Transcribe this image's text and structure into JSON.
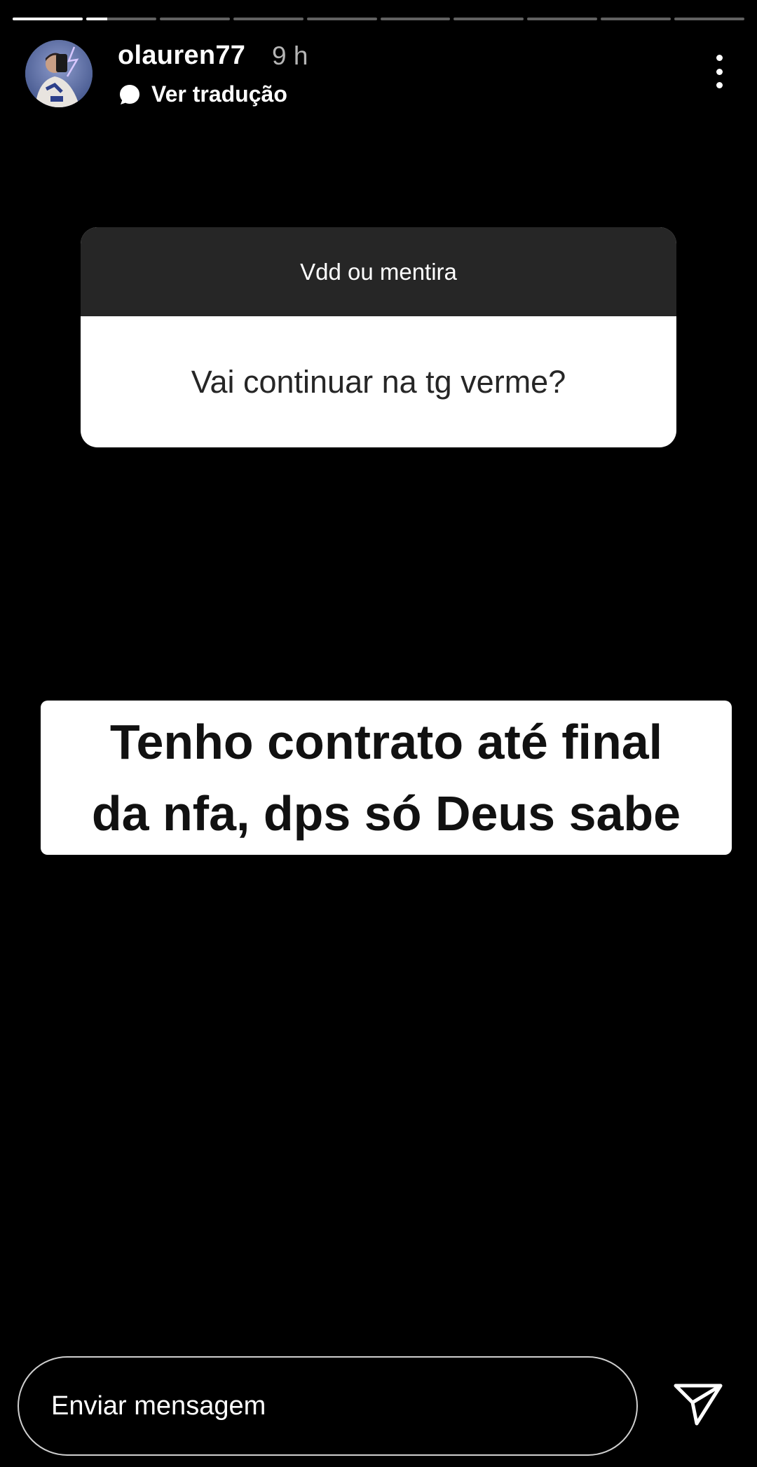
{
  "story": {
    "segments": [
      {
        "progress": 1.0
      },
      {
        "progress": 0.3
      },
      {
        "progress": 0
      },
      {
        "progress": 0
      },
      {
        "progress": 0
      },
      {
        "progress": 0
      },
      {
        "progress": 0
      },
      {
        "progress": 0
      },
      {
        "progress": 0
      },
      {
        "progress": 0
      }
    ]
  },
  "header": {
    "username": "olauren77",
    "time": "9 h",
    "translate_label": "Ver tradução",
    "avatar_icon": "profile-photo",
    "more_icon": "more-vertical-icon"
  },
  "question_card": {
    "header": "Vdd ou mentira",
    "question": "Vai continuar na tg verme?"
  },
  "answer_text": {
    "line1": "Tenho contrato até final",
    "line2": "da nfa, dps só Deus sabe"
  },
  "footer": {
    "message_placeholder": "Enviar mensagem",
    "send_icon": "send-icon"
  }
}
